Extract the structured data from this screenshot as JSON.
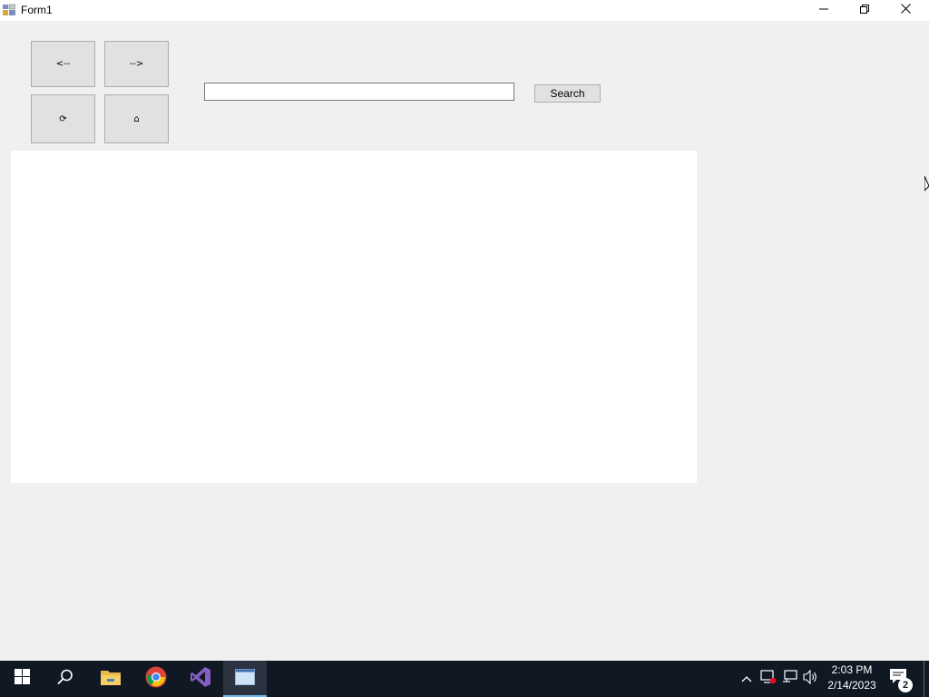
{
  "window": {
    "title": "Form1",
    "app_icon": "winforms-app-icon",
    "controls": {
      "minimize_icon": "minimize-icon",
      "maximize_icon": "restore-icon",
      "close_icon": "close-icon"
    }
  },
  "toolbar": {
    "back_label": "<--",
    "forward_label": "-->",
    "refresh_label": "⟳",
    "home_label": "⌂"
  },
  "search": {
    "value": "",
    "placeholder": "",
    "button_label": "Search"
  },
  "taskbar": {
    "items": [
      {
        "name": "start",
        "icon": "windows-start-icon"
      },
      {
        "name": "search",
        "icon": "search-icon"
      },
      {
        "name": "file-explorer",
        "icon": "folder-icon"
      },
      {
        "name": "chrome",
        "icon": "chrome-icon"
      },
      {
        "name": "visual-studio",
        "icon": "visual-studio-icon"
      },
      {
        "name": "form1",
        "icon": "window-icon",
        "active": true
      }
    ],
    "tray": {
      "icons": [
        "chevron-up-icon",
        "network-alert-icon",
        "network-icon",
        "volume-icon"
      ],
      "time": "2:03 PM",
      "date": "2/14/2023",
      "notification_count": "2"
    }
  },
  "colors": {
    "form_bg": "#f0f0f0",
    "taskbar_bg": "#101824",
    "button_bg": "#e1e1e1",
    "active_task": "#76b9ed"
  }
}
